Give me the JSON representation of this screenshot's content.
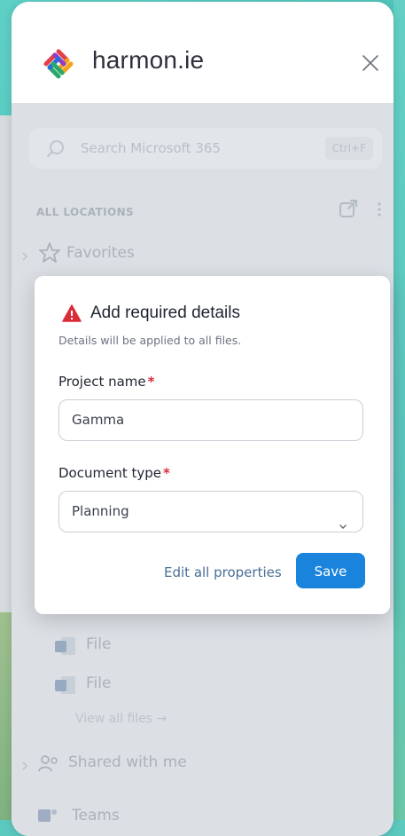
{
  "app": {
    "title": "harmon.ie",
    "logo_icon": "harmonie-logo-icon",
    "close_icon": "close-icon"
  },
  "search": {
    "placeholder": "Search Microsoft 365",
    "shortcut": "Ctrl+F"
  },
  "locations": {
    "heading": "ALL LOCATIONS",
    "favorites_label": "Favorites",
    "files": [
      "File",
      "File"
    ],
    "view_all": "View all files →",
    "shared_label": "Shared with me",
    "teams_label": "Teams"
  },
  "dialog": {
    "title": "Add required details",
    "subtitle": "Details will be applied to all files.",
    "project_name_label": "Project name",
    "project_name_value": "Gamma",
    "document_type_label": "Document type",
    "document_type_value": "Planning",
    "required_marker": "*",
    "edit_all_label": "Edit all properties",
    "save_label": "Save"
  },
  "colors": {
    "accent": "#1a84dc",
    "required": "#d92d3a",
    "warning": "#d92d3a",
    "background_teal": "#5cc9bf"
  }
}
